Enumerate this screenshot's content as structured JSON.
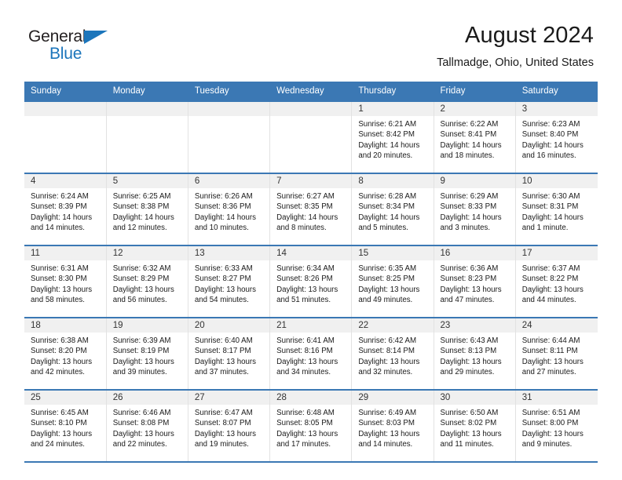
{
  "brand": {
    "name_line1": "General",
    "name_line2": "Blue",
    "triangle_icon": "triangle-icon",
    "color_primary": "#1b75bb",
    "color_text": "#231f20"
  },
  "header": {
    "title": "August 2024",
    "subtitle": "Tallmadge, Ohio, United States"
  },
  "theme": {
    "header_bg": "#3b78b4",
    "header_text": "#ffffff",
    "daynum_band_bg": "#f0f0f0",
    "cell_border": "#e2e2e2",
    "page_bg": "#ffffff"
  },
  "calendar": {
    "weekdays": [
      "Sunday",
      "Monday",
      "Tuesday",
      "Wednesday",
      "Thursday",
      "Friday",
      "Saturday"
    ],
    "labels": {
      "sunrise": "Sunrise:",
      "sunset": "Sunset:",
      "daylight": "Daylight:"
    },
    "weeks": [
      [
        {
          "day": "",
          "empty": true
        },
        {
          "day": "",
          "empty": true
        },
        {
          "day": "",
          "empty": true
        },
        {
          "day": "",
          "empty": true
        },
        {
          "day": "1",
          "sunrise": "Sunrise: 6:21 AM",
          "sunset": "Sunset: 8:42 PM",
          "daylight_line1": "Daylight: 14 hours",
          "daylight_line2": "and 20 minutes."
        },
        {
          "day": "2",
          "sunrise": "Sunrise: 6:22 AM",
          "sunset": "Sunset: 8:41 PM",
          "daylight_line1": "Daylight: 14 hours",
          "daylight_line2": "and 18 minutes."
        },
        {
          "day": "3",
          "sunrise": "Sunrise: 6:23 AM",
          "sunset": "Sunset: 8:40 PM",
          "daylight_line1": "Daylight: 14 hours",
          "daylight_line2": "and 16 minutes."
        }
      ],
      [
        {
          "day": "4",
          "sunrise": "Sunrise: 6:24 AM",
          "sunset": "Sunset: 8:39 PM",
          "daylight_line1": "Daylight: 14 hours",
          "daylight_line2": "and 14 minutes."
        },
        {
          "day": "5",
          "sunrise": "Sunrise: 6:25 AM",
          "sunset": "Sunset: 8:38 PM",
          "daylight_line1": "Daylight: 14 hours",
          "daylight_line2": "and 12 minutes."
        },
        {
          "day": "6",
          "sunrise": "Sunrise: 6:26 AM",
          "sunset": "Sunset: 8:36 PM",
          "daylight_line1": "Daylight: 14 hours",
          "daylight_line2": "and 10 minutes."
        },
        {
          "day": "7",
          "sunrise": "Sunrise: 6:27 AM",
          "sunset": "Sunset: 8:35 PM",
          "daylight_line1": "Daylight: 14 hours",
          "daylight_line2": "and 8 minutes."
        },
        {
          "day": "8",
          "sunrise": "Sunrise: 6:28 AM",
          "sunset": "Sunset: 8:34 PM",
          "daylight_line1": "Daylight: 14 hours",
          "daylight_line2": "and 5 minutes."
        },
        {
          "day": "9",
          "sunrise": "Sunrise: 6:29 AM",
          "sunset": "Sunset: 8:33 PM",
          "daylight_line1": "Daylight: 14 hours",
          "daylight_line2": "and 3 minutes."
        },
        {
          "day": "10",
          "sunrise": "Sunrise: 6:30 AM",
          "sunset": "Sunset: 8:31 PM",
          "daylight_line1": "Daylight: 14 hours",
          "daylight_line2": "and 1 minute."
        }
      ],
      [
        {
          "day": "11",
          "sunrise": "Sunrise: 6:31 AM",
          "sunset": "Sunset: 8:30 PM",
          "daylight_line1": "Daylight: 13 hours",
          "daylight_line2": "and 58 minutes."
        },
        {
          "day": "12",
          "sunrise": "Sunrise: 6:32 AM",
          "sunset": "Sunset: 8:29 PM",
          "daylight_line1": "Daylight: 13 hours",
          "daylight_line2": "and 56 minutes."
        },
        {
          "day": "13",
          "sunrise": "Sunrise: 6:33 AM",
          "sunset": "Sunset: 8:27 PM",
          "daylight_line1": "Daylight: 13 hours",
          "daylight_line2": "and 54 minutes."
        },
        {
          "day": "14",
          "sunrise": "Sunrise: 6:34 AM",
          "sunset": "Sunset: 8:26 PM",
          "daylight_line1": "Daylight: 13 hours",
          "daylight_line2": "and 51 minutes."
        },
        {
          "day": "15",
          "sunrise": "Sunrise: 6:35 AM",
          "sunset": "Sunset: 8:25 PM",
          "daylight_line1": "Daylight: 13 hours",
          "daylight_line2": "and 49 minutes."
        },
        {
          "day": "16",
          "sunrise": "Sunrise: 6:36 AM",
          "sunset": "Sunset: 8:23 PM",
          "daylight_line1": "Daylight: 13 hours",
          "daylight_line2": "and 47 minutes."
        },
        {
          "day": "17",
          "sunrise": "Sunrise: 6:37 AM",
          "sunset": "Sunset: 8:22 PM",
          "daylight_line1": "Daylight: 13 hours",
          "daylight_line2": "and 44 minutes."
        }
      ],
      [
        {
          "day": "18",
          "sunrise": "Sunrise: 6:38 AM",
          "sunset": "Sunset: 8:20 PM",
          "daylight_line1": "Daylight: 13 hours",
          "daylight_line2": "and 42 minutes."
        },
        {
          "day": "19",
          "sunrise": "Sunrise: 6:39 AM",
          "sunset": "Sunset: 8:19 PM",
          "daylight_line1": "Daylight: 13 hours",
          "daylight_line2": "and 39 minutes."
        },
        {
          "day": "20",
          "sunrise": "Sunrise: 6:40 AM",
          "sunset": "Sunset: 8:17 PM",
          "daylight_line1": "Daylight: 13 hours",
          "daylight_line2": "and 37 minutes."
        },
        {
          "day": "21",
          "sunrise": "Sunrise: 6:41 AM",
          "sunset": "Sunset: 8:16 PM",
          "daylight_line1": "Daylight: 13 hours",
          "daylight_line2": "and 34 minutes."
        },
        {
          "day": "22",
          "sunrise": "Sunrise: 6:42 AM",
          "sunset": "Sunset: 8:14 PM",
          "daylight_line1": "Daylight: 13 hours",
          "daylight_line2": "and 32 minutes."
        },
        {
          "day": "23",
          "sunrise": "Sunrise: 6:43 AM",
          "sunset": "Sunset: 8:13 PM",
          "daylight_line1": "Daylight: 13 hours",
          "daylight_line2": "and 29 minutes."
        },
        {
          "day": "24",
          "sunrise": "Sunrise: 6:44 AM",
          "sunset": "Sunset: 8:11 PM",
          "daylight_line1": "Daylight: 13 hours",
          "daylight_line2": "and 27 minutes."
        }
      ],
      [
        {
          "day": "25",
          "sunrise": "Sunrise: 6:45 AM",
          "sunset": "Sunset: 8:10 PM",
          "daylight_line1": "Daylight: 13 hours",
          "daylight_line2": "and 24 minutes."
        },
        {
          "day": "26",
          "sunrise": "Sunrise: 6:46 AM",
          "sunset": "Sunset: 8:08 PM",
          "daylight_line1": "Daylight: 13 hours",
          "daylight_line2": "and 22 minutes."
        },
        {
          "day": "27",
          "sunrise": "Sunrise: 6:47 AM",
          "sunset": "Sunset: 8:07 PM",
          "daylight_line1": "Daylight: 13 hours",
          "daylight_line2": "and 19 minutes."
        },
        {
          "day": "28",
          "sunrise": "Sunrise: 6:48 AM",
          "sunset": "Sunset: 8:05 PM",
          "daylight_line1": "Daylight: 13 hours",
          "daylight_line2": "and 17 minutes."
        },
        {
          "day": "29",
          "sunrise": "Sunrise: 6:49 AM",
          "sunset": "Sunset: 8:03 PM",
          "daylight_line1": "Daylight: 13 hours",
          "daylight_line2": "and 14 minutes."
        },
        {
          "day": "30",
          "sunrise": "Sunrise: 6:50 AM",
          "sunset": "Sunset: 8:02 PM",
          "daylight_line1": "Daylight: 13 hours",
          "daylight_line2": "and 11 minutes."
        },
        {
          "day": "31",
          "sunrise": "Sunrise: 6:51 AM",
          "sunset": "Sunset: 8:00 PM",
          "daylight_line1": "Daylight: 13 hours",
          "daylight_line2": "and 9 minutes."
        }
      ]
    ]
  }
}
